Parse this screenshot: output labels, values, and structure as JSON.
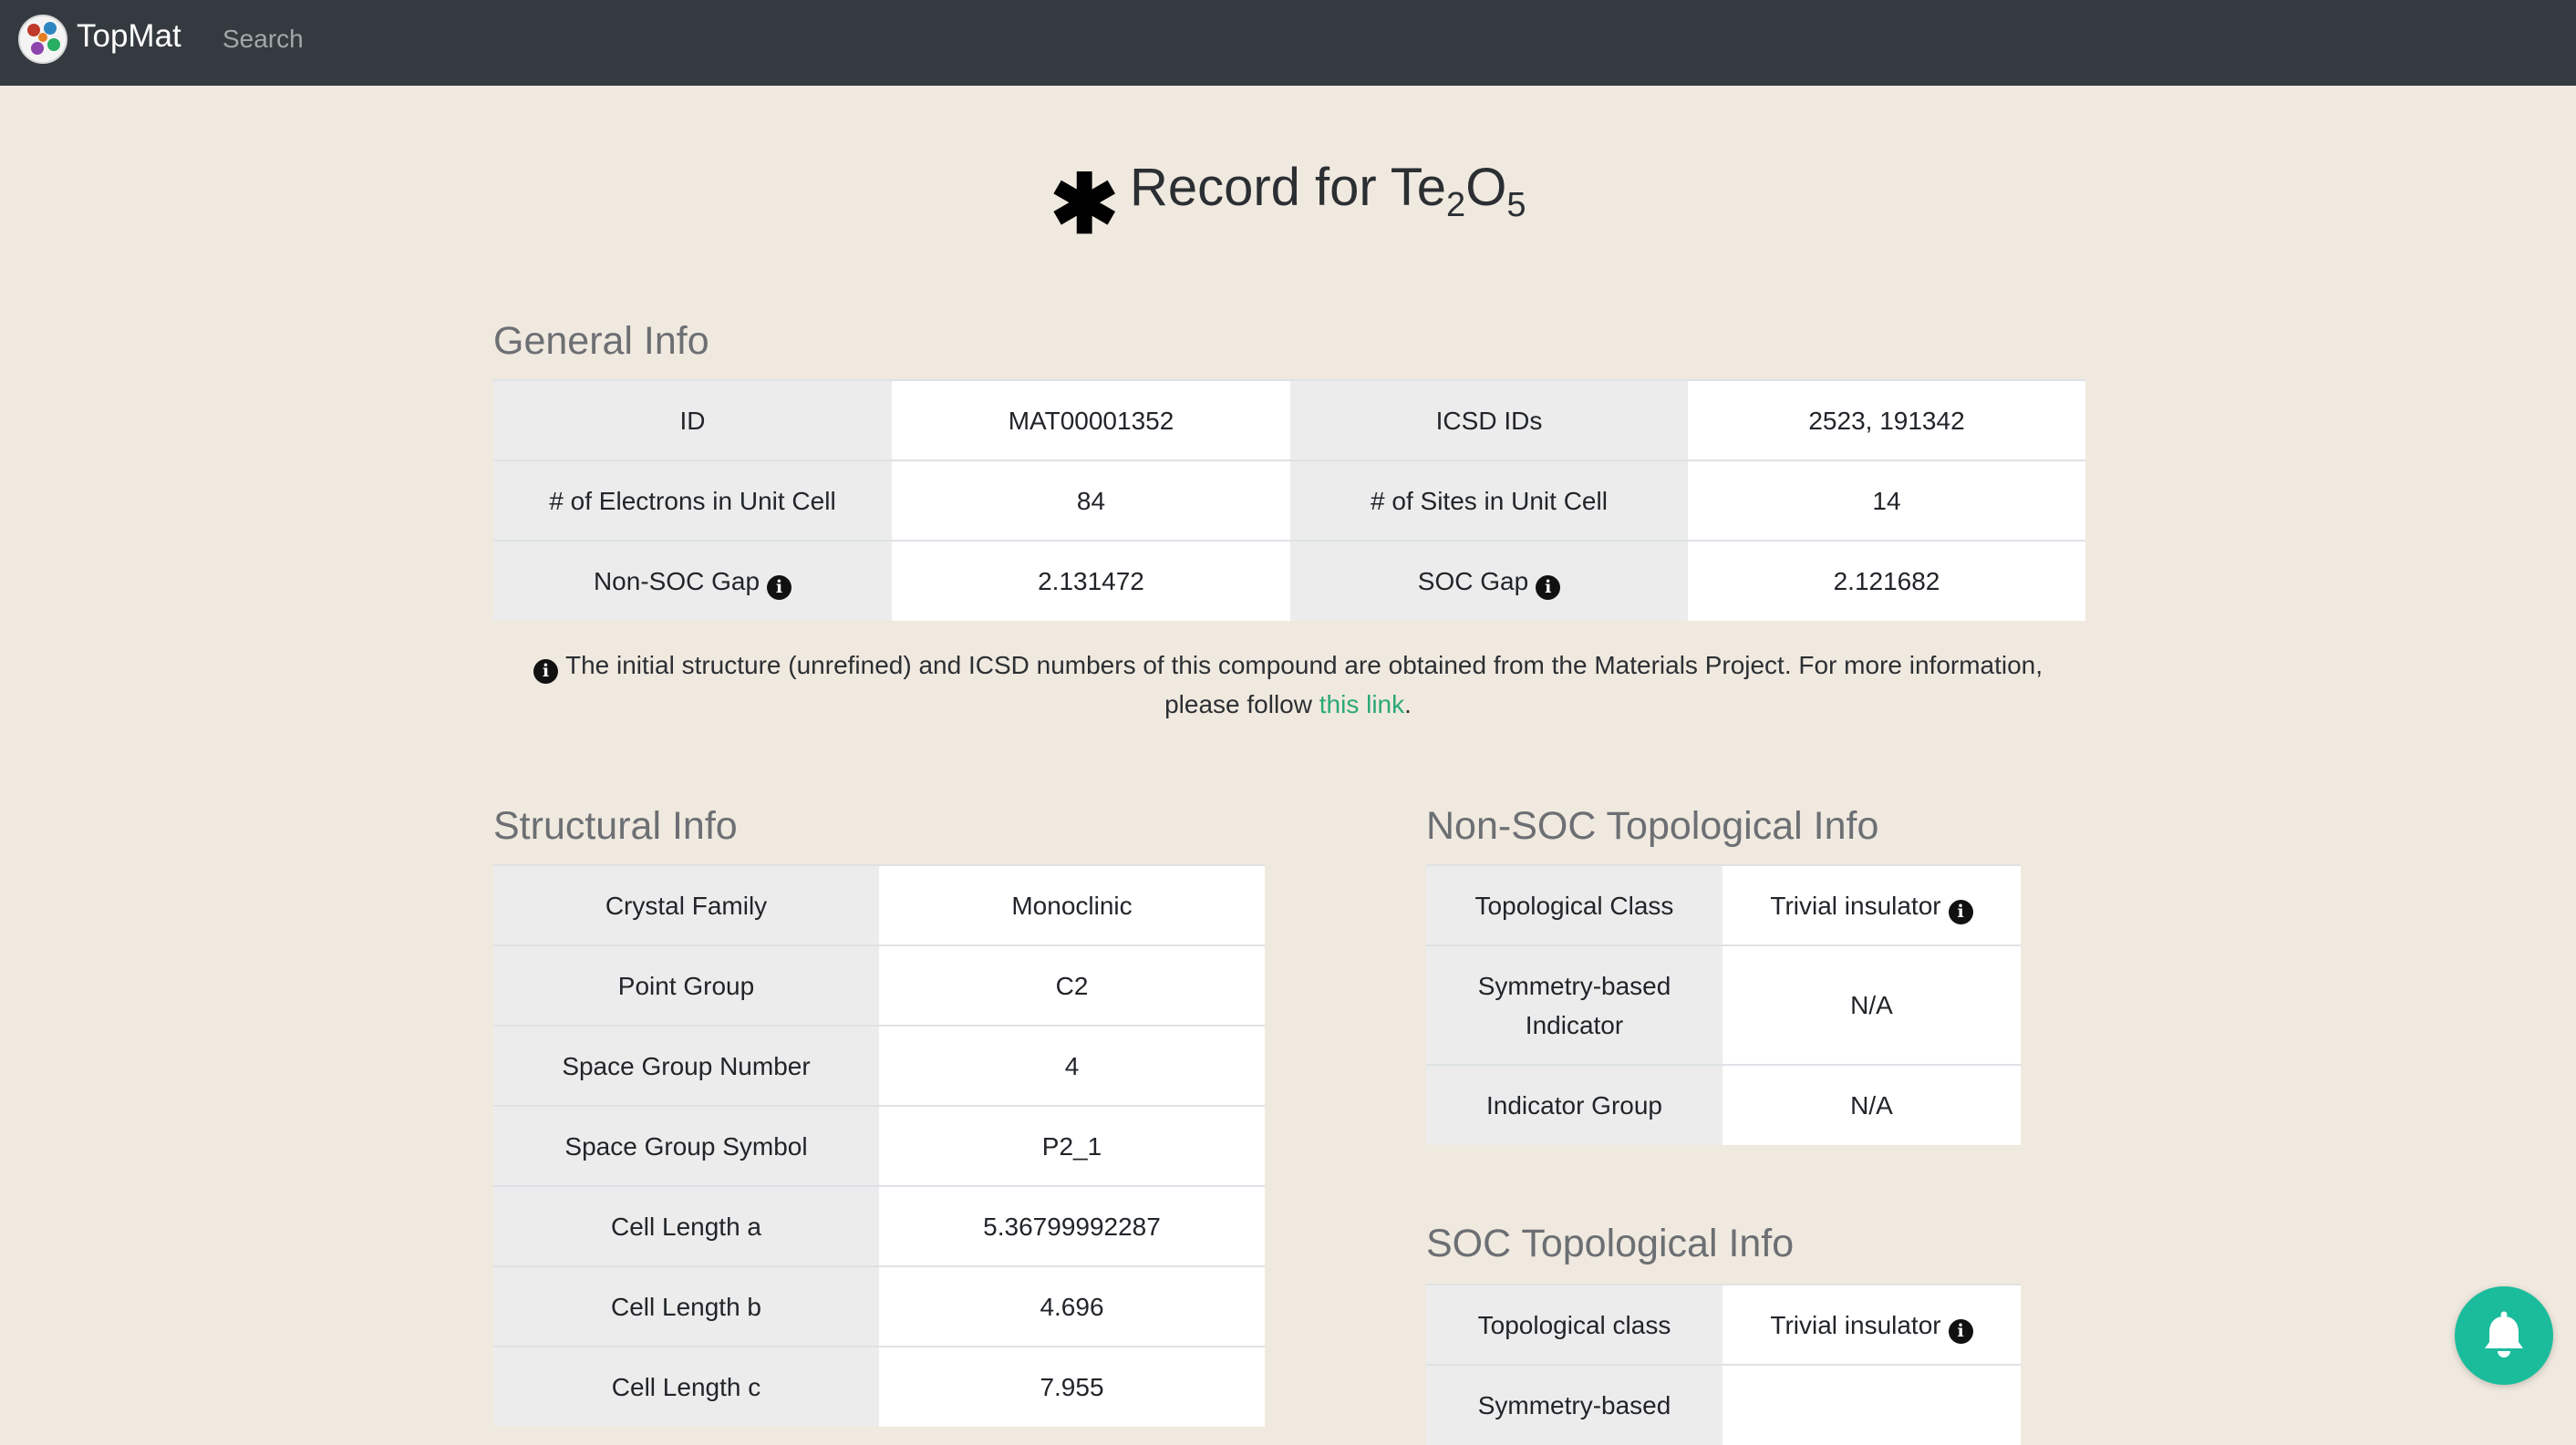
{
  "navbar": {
    "brand": "TopMat",
    "search_link": "Search",
    "logo_icon": "topmat-logo-icon"
  },
  "page": {
    "title_prefix": "Record for Te",
    "title_sub1": "2",
    "title_mid": "O",
    "title_sub2": "5"
  },
  "general": {
    "heading": "General Info",
    "rows": [
      {
        "k1": "ID",
        "v1": "MAT00001352",
        "k2": "ICSD IDs",
        "v2": "2523, 191342"
      },
      {
        "k1": "# of Electrons in Unit Cell",
        "v1": "84",
        "k2": "# of Sites in Unit Cell",
        "v2": "14"
      },
      {
        "k1": "Non-SOC Gap",
        "v1": "2.131472",
        "k2": "SOC Gap",
        "v2": "2.121682"
      }
    ],
    "note_text": "The initial structure (unrefined) and ICSD numbers of this compound are obtained from the Materials Project. For more information, please follow ",
    "note_link": "this link",
    "note_end": "."
  },
  "structural": {
    "heading": "Structural Info",
    "rows": [
      {
        "k": "Crystal Family",
        "v": "Monoclinic"
      },
      {
        "k": "Point Group",
        "v": "C2"
      },
      {
        "k": "Space Group Number",
        "v": "4"
      },
      {
        "k": "Space Group Symbol",
        "v": "P2_1"
      },
      {
        "k": "Cell Length a",
        "v": "5.36799992287"
      },
      {
        "k": "Cell Length b",
        "v": "4.696"
      },
      {
        "k": "Cell Length c",
        "v": "7.955"
      }
    ]
  },
  "nonsoc": {
    "heading": "Non-SOC Topological Info",
    "rows": [
      {
        "k": "Topological Class",
        "v": "Trivial insulator"
      },
      {
        "k": "Symmetry-based Indicator",
        "v": "N/A"
      },
      {
        "k": "Indicator Group",
        "v": "N/A"
      }
    ]
  },
  "soc": {
    "heading": "SOC Topological Info",
    "rows": [
      {
        "k": "Topological class",
        "v": "Trivial insulator"
      },
      {
        "k": "Symmetry-based",
        "v": ""
      }
    ]
  },
  "colors": {
    "navbar_bg": "#343a40",
    "page_bg": "#f0e9df",
    "link": "#2aa876",
    "notify_button": "#1abc9c"
  }
}
